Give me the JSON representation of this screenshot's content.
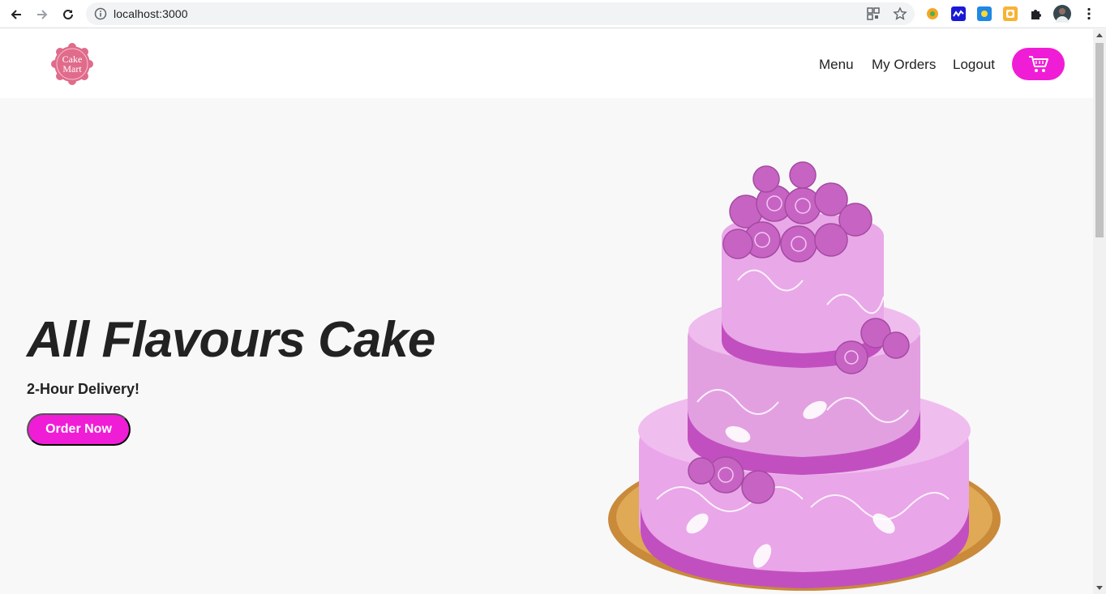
{
  "browser": {
    "url": "localhost:3000"
  },
  "nav": {
    "logo_text_line1": "Cake",
    "logo_text_line2": "Mart",
    "links": [
      "Menu",
      "My Orders",
      "Logout"
    ]
  },
  "hero": {
    "title": "All Flavours Cake",
    "subtitle": "2-Hour Delivery!",
    "cta_label": "Order Now"
  },
  "colors": {
    "accent": "#f01dd6",
    "page_bg": "#f8f8f8",
    "cake_pink": "#e9a6e8",
    "cake_band": "#c24fc0"
  }
}
